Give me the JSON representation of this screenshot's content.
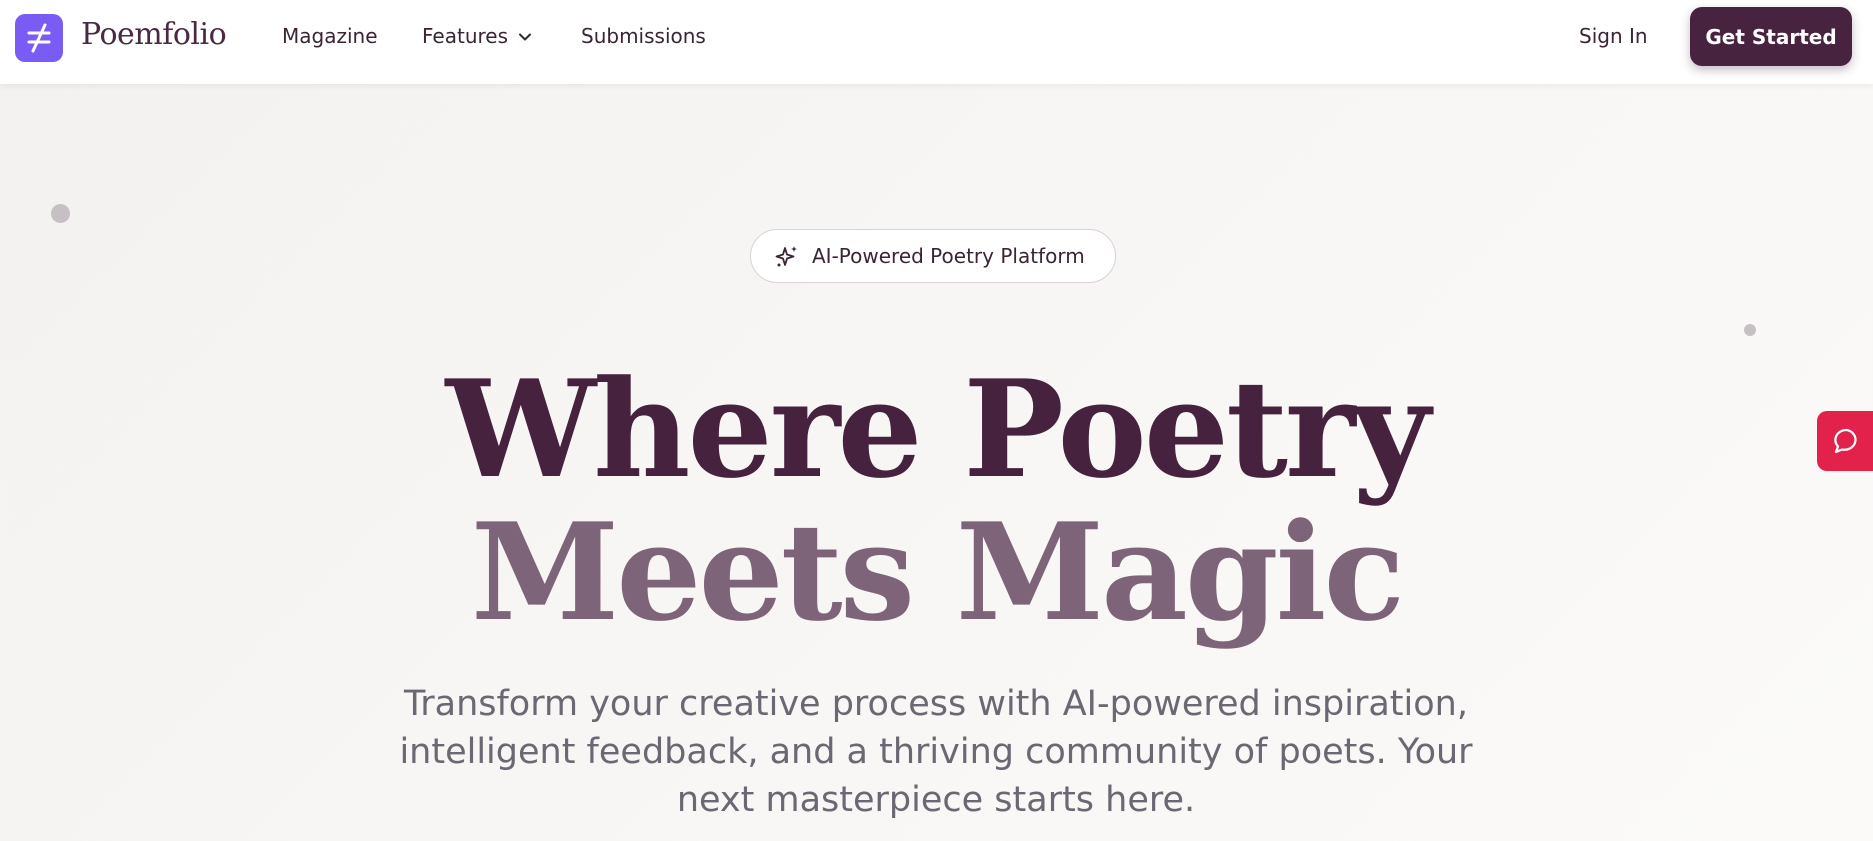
{
  "navbar": {
    "brand": "Poemfolio",
    "logo_icon": "not-equal-icon",
    "links": [
      "Magazine",
      "Features",
      "Submissions"
    ],
    "features_dropdown_icon": "chevron-down-icon",
    "sign_in": "Sign In",
    "cta": "Get Started"
  },
  "hero": {
    "badge": {
      "icon": "sparkles-icon",
      "text": "AI-Powered Poetry Platform"
    },
    "headline_line1": "Where Poetry",
    "headline_line2": "Meets Magic",
    "subtitle": "Transform your creative process with AI-powered inspiration, intelligent feedback, and a thriving community of poets. Your next masterpiece starts here."
  },
  "chat_widget": {
    "icon": "chat-bubble-icon"
  },
  "colors": {
    "brand_dark": "#472340",
    "headline_primary": "#46223f",
    "headline_secondary": "#7d6479",
    "logo_accent": "#7a5cf5",
    "chat_accent": "#e3224c",
    "subtitle_text": "#6a6872"
  }
}
